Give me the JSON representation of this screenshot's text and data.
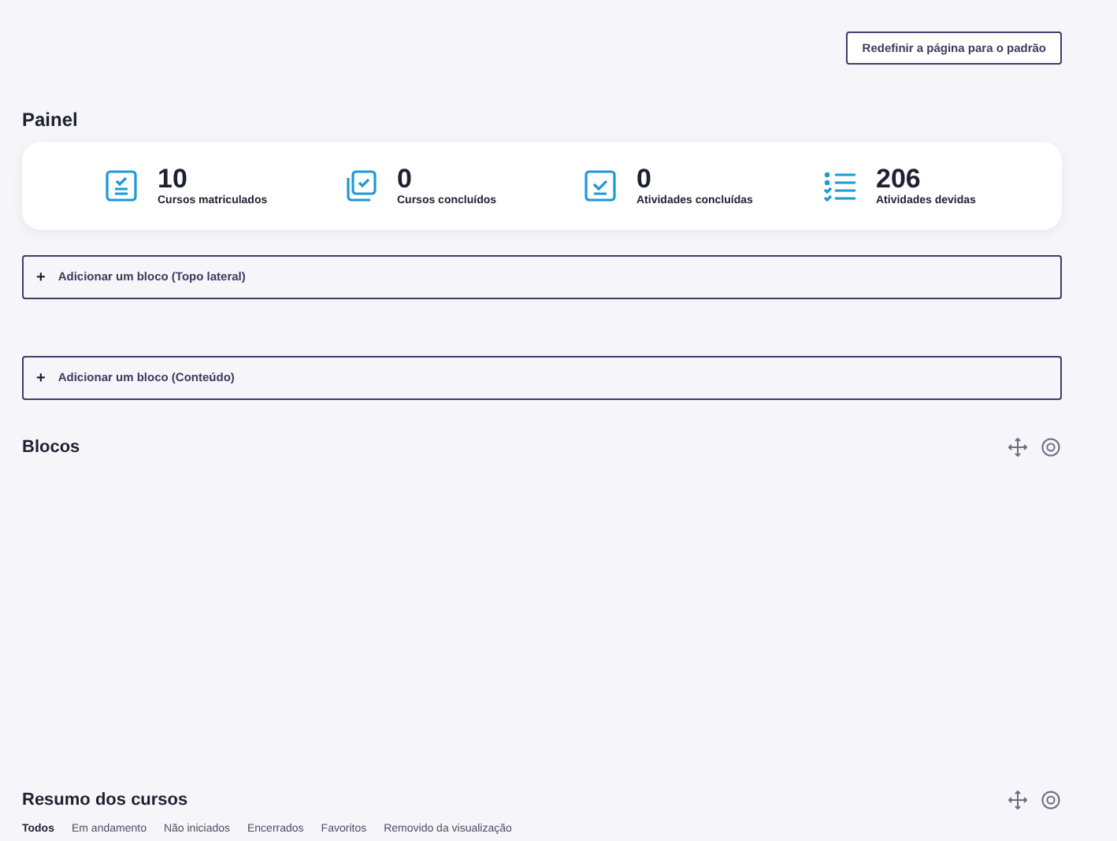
{
  "reset_button": "Redefinir a página para o padrão",
  "dashboard": {
    "title": "Painel",
    "stats": [
      {
        "kind": "enrolled",
        "value": "10",
        "label": "Cursos matriculados"
      },
      {
        "kind": "courses_done",
        "value": "0",
        "label": "Cursos concluídos"
      },
      {
        "kind": "activities_done",
        "value": "0",
        "label": "Atividades concluídas"
      },
      {
        "kind": "due",
        "value": "206",
        "label": "Atividades devidas"
      }
    ]
  },
  "add_block_top": {
    "icon": "+",
    "label": "Adicionar um bloco (Topo lateral)"
  },
  "add_block_content": {
    "icon": "+",
    "label": "Adicionar um bloco (Conteúdo)"
  },
  "blocks_section": {
    "title": "Blocos"
  },
  "course_overview": {
    "title": "Resumo dos cursos",
    "filters": [
      {
        "label": "Todos",
        "selected": true
      },
      {
        "label": "Em andamento",
        "selected": false
      },
      {
        "label": "Não iniciados",
        "selected": false
      },
      {
        "label": "Encerrados",
        "selected": false
      },
      {
        "label": "Favoritos",
        "selected": false
      },
      {
        "label": "Removido da visualização",
        "selected": false
      }
    ]
  }
}
